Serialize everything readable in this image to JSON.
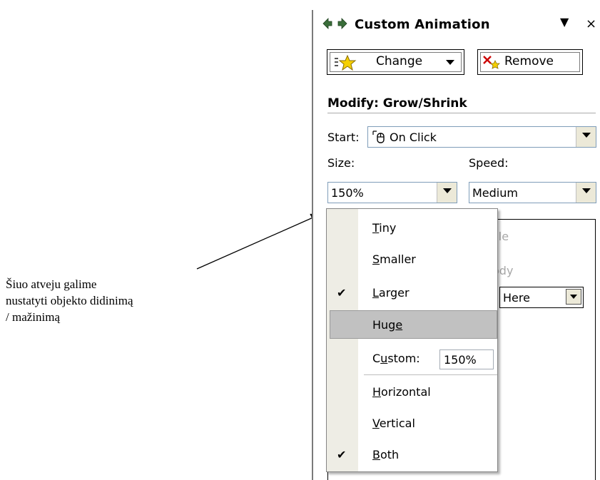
{
  "annotation": {
    "line1": "Šiuo atveju galime",
    "line2": "nustatyti objekto didinimą",
    "line3": "/  mažinimą"
  },
  "taskpane": {
    "title": "Custom Animation",
    "dropdown_glyph": "▼",
    "close_glyph": "×",
    "change_label": "Change",
    "remove_label": "Remove",
    "modify_title": "Modify: Grow/Shrink",
    "start_label": "Start:",
    "start_value": "On Click",
    "size_label": "Size:",
    "size_value": "150%",
    "speed_label": "Speed:",
    "speed_value": "Medium",
    "ghost_1": "cle",
    "ghost_2": "ody",
    "here_value": "Here"
  },
  "menu": {
    "tiny_rest": "iny",
    "tiny_key": "T",
    "smaller_rest": "maller",
    "smaller_key": "S",
    "larger_rest": "arger",
    "larger_key": "L",
    "huge_pre": "Hug",
    "huge_key": "e",
    "custom_pre": "C",
    "custom_key": "u",
    "custom_post": "stom:",
    "custom_value": "150%",
    "horizontal_key": "H",
    "horizontal_rest": "orizontal",
    "vertical_key": "V",
    "vertical_rest": "ertical",
    "both_key": "B",
    "both_rest": "oth",
    "checkmark": "✔"
  },
  "colors": {
    "highlight": "#c1c1c1",
    "menu_strip": "#eeede5",
    "star": "#f5d000",
    "remove_x": "#cc0000"
  }
}
